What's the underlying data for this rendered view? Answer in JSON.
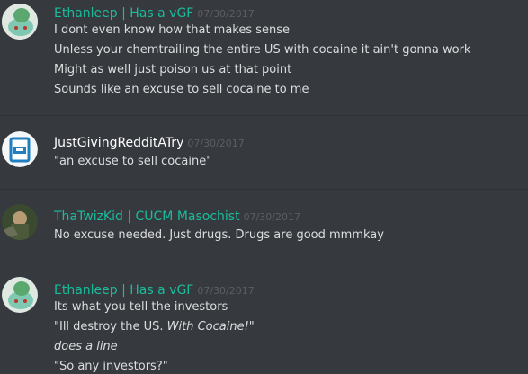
{
  "colors": {
    "background": "#36393e",
    "divider": "#2f3136",
    "text": "#dcddde",
    "teal_username": "#1abc9c",
    "timestamp": "#5b5e63"
  },
  "messages": [
    {
      "username": "Ethanleep | Has a vGF",
      "timestamp": "07/30/2017",
      "avatar_icon": "bulbasaur-avatar",
      "lines": [
        "I dont even know how that makes sense",
        "Unless your chemtrailing the entire US with cocaine it ain't gonna work",
        "Might as well just poison us at that point",
        "Sounds like an excuse to sell cocaine to me"
      ]
    },
    {
      "username": "JustGivingRedditATry",
      "timestamp": "07/30/2017",
      "avatar_icon": "blue-box-avatar",
      "lines": [
        "\"an excuse to sell cocaine\""
      ]
    },
    {
      "username": "ThaTwizKid | CUCM Masochist",
      "timestamp": "07/30/2017",
      "avatar_icon": "photo-avatar",
      "lines": [
        "No excuse needed. Just drugs. Drugs are good mmmkay"
      ]
    },
    {
      "username": "Ethanleep | Has a vGF",
      "timestamp": "07/30/2017",
      "avatar_icon": "bulbasaur-avatar",
      "line1": "Its what you tell the investors",
      "line2_prefix": "\"Ill destroy the US. ",
      "line2_italic": "With Cocaine!",
      "line2_suffix": "\"",
      "line3_italic": "does a line",
      "line4": "\"So any investors?\""
    }
  ]
}
